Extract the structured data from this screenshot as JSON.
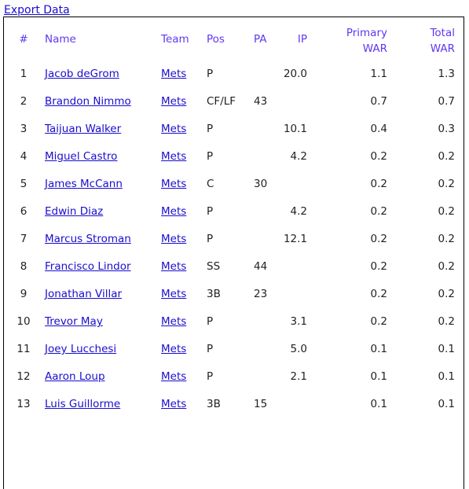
{
  "export_label": "Export Data",
  "columns": {
    "num": "#",
    "name": "Name",
    "team": "Team",
    "pos": "Pos",
    "pa": "PA",
    "ip": "IP",
    "primary_war_1": "Primary",
    "primary_war_2": "WAR",
    "total_war_1": "Total",
    "total_war_2": "WAR"
  },
  "rows": [
    {
      "num": "1",
      "name": "Jacob deGrom",
      "team": "Mets",
      "pos": "P",
      "pa": "",
      "ip": "20.0",
      "pwar": "1.1",
      "twar": "1.3"
    },
    {
      "num": "2",
      "name": "Brandon Nimmo",
      "team": "Mets",
      "pos": "CF/LF",
      "pa": "43",
      "ip": "",
      "pwar": "0.7",
      "twar": "0.7"
    },
    {
      "num": "3",
      "name": "Taijuan Walker",
      "team": "Mets",
      "pos": "P",
      "pa": "",
      "ip": "10.1",
      "pwar": "0.4",
      "twar": "0.3"
    },
    {
      "num": "4",
      "name": "Miguel Castro",
      "team": "Mets",
      "pos": "P",
      "pa": "",
      "ip": "4.2",
      "pwar": "0.2",
      "twar": "0.2"
    },
    {
      "num": "5",
      "name": "James McCann",
      "team": "Mets",
      "pos": "C",
      "pa": "30",
      "ip": "",
      "pwar": "0.2",
      "twar": "0.2"
    },
    {
      "num": "6",
      "name": "Edwin Diaz",
      "team": "Mets",
      "pos": "P",
      "pa": "",
      "ip": "4.2",
      "pwar": "0.2",
      "twar": "0.2"
    },
    {
      "num": "7",
      "name": "Marcus Stroman",
      "team": "Mets",
      "pos": "P",
      "pa": "",
      "ip": "12.1",
      "pwar": "0.2",
      "twar": "0.2"
    },
    {
      "num": "8",
      "name": "Francisco Lindor",
      "team": "Mets",
      "pos": "SS",
      "pa": "44",
      "ip": "",
      "pwar": "0.2",
      "twar": "0.2"
    },
    {
      "num": "9",
      "name": "Jonathan Villar",
      "team": "Mets",
      "pos": "3B",
      "pa": "23",
      "ip": "",
      "pwar": "0.2",
      "twar": "0.2"
    },
    {
      "num": "10",
      "name": "Trevor May",
      "team": "Mets",
      "pos": "P",
      "pa": "",
      "ip": "3.1",
      "pwar": "0.2",
      "twar": "0.2"
    },
    {
      "num": "11",
      "name": "Joey Lucchesi",
      "team": "Mets",
      "pos": "P",
      "pa": "",
      "ip": "5.0",
      "pwar": "0.1",
      "twar": "0.1"
    },
    {
      "num": "12",
      "name": "Aaron Loup",
      "team": "Mets",
      "pos": "P",
      "pa": "",
      "ip": "2.1",
      "pwar": "0.1",
      "twar": "0.1"
    },
    {
      "num": "13",
      "name": "Luis Guillorme",
      "team": "Mets",
      "pos": "3B",
      "pa": "15",
      "ip": "",
      "pwar": "0.1",
      "twar": "0.1"
    }
  ]
}
